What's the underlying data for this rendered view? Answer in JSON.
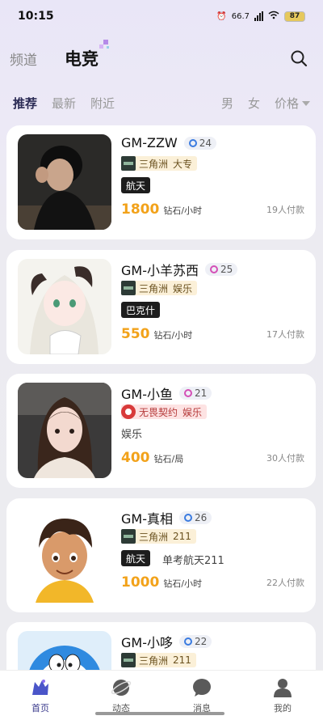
{
  "status": {
    "time": "10:15",
    "battery": "87",
    "net_speed": "66.7"
  },
  "top_nav": {
    "tabs": [
      {
        "label": "频道"
      },
      {
        "label": "电竞"
      }
    ]
  },
  "filters": {
    "left": [
      {
        "label": "推荐"
      },
      {
        "label": "最新"
      },
      {
        "label": "附近"
      }
    ],
    "male": "男",
    "female": "女",
    "price": "价格"
  },
  "cards": [
    {
      "name": "GM-ZZW",
      "level": "24",
      "game": "三角洲",
      "game_sub": "大专",
      "dark_tag": "航天",
      "desc": "",
      "price": "1800",
      "unit": "钻石/小时",
      "paid": "19人付款"
    },
    {
      "name": "GM-小羊苏西",
      "level": "25",
      "game": "三角洲",
      "game_sub": "娱乐",
      "dark_tag": "巴克什",
      "desc": "",
      "price": "550",
      "unit": "钻石/小时",
      "paid": "17人付款"
    },
    {
      "name": "GM-小鱼",
      "level": "21",
      "game": "无畏契约",
      "game_sub": "娱乐",
      "dark_tag": "",
      "desc": "娱乐",
      "price": "400",
      "unit": "钻石/局",
      "paid": "30人付款"
    },
    {
      "name": "GM-真相",
      "level": "26",
      "game": "三角洲",
      "game_sub": "211",
      "dark_tag": "航天",
      "desc": "单考航天211",
      "price": "1000",
      "unit": "钻石/小时",
      "paid": "22人付款"
    },
    {
      "name": "GM-小哆",
      "level": "22",
      "game": "三角洲",
      "game_sub": "211",
      "dark_tag": "",
      "desc": "",
      "price": "",
      "unit": "",
      "paid": ""
    }
  ],
  "bottom_nav": [
    {
      "label": "首页"
    },
    {
      "label": "动态"
    },
    {
      "label": "消息"
    },
    {
      "label": "我的"
    }
  ]
}
